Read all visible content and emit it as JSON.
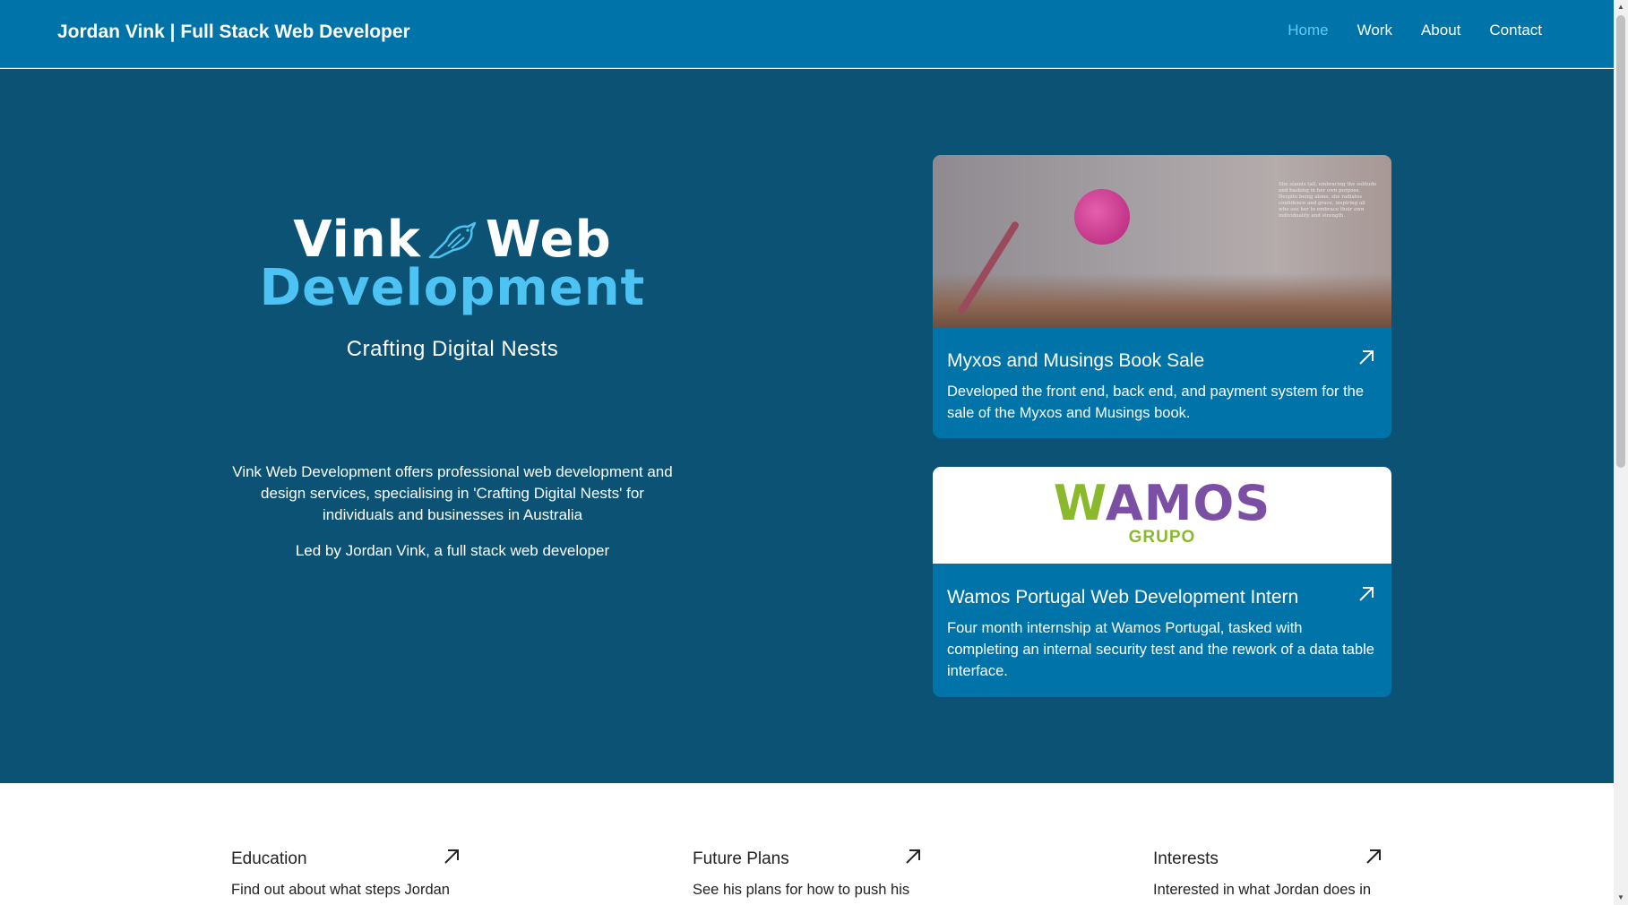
{
  "header": {
    "brand": "Jordan Vink | Full Stack Web Developer",
    "nav": [
      "Home",
      "Work",
      "About",
      "Contact"
    ],
    "active": "Home"
  },
  "hero": {
    "logo_line1_a": "Vink",
    "logo_line1_b": "Web",
    "logo_line2": "Development",
    "tagline": "Crafting Digital Nests",
    "intro": "Vink Web Development offers professional web development and design services, specialising in 'Crafting Digital Nests' for individuals and businesses in Australia",
    "led_by": "Led by Jordan Vink, a full stack web developer"
  },
  "cards": [
    {
      "title": "Myxos and Musings Book Sale",
      "desc": "Developed the front end, back end, and payment system for the sale of the Myxos and Musings book."
    },
    {
      "title": "Wamos Portugal Web Development Intern",
      "desc": "Four month internship at Wamos Portugal, tasked with completing an internal security test and the rework of a data table interface.",
      "logo_w": "W",
      "logo_rest": "AMOS",
      "logo_sub": "GRUPO"
    }
  ],
  "features": [
    {
      "title": "Education",
      "desc": "Find out about what steps Jordan"
    },
    {
      "title": "Future Plans",
      "desc": "See his plans for how to push his"
    },
    {
      "title": "Interests",
      "desc": "Interested in what Jordan does in"
    }
  ],
  "colors": {
    "header_bg": "#0073a8",
    "hero_bg": "#0b5275",
    "accent": "#4cc3f2",
    "card_bg": "#0073a8"
  },
  "icons": {
    "arrow": "arrow-up-right-icon",
    "bird": "bird-icon"
  }
}
